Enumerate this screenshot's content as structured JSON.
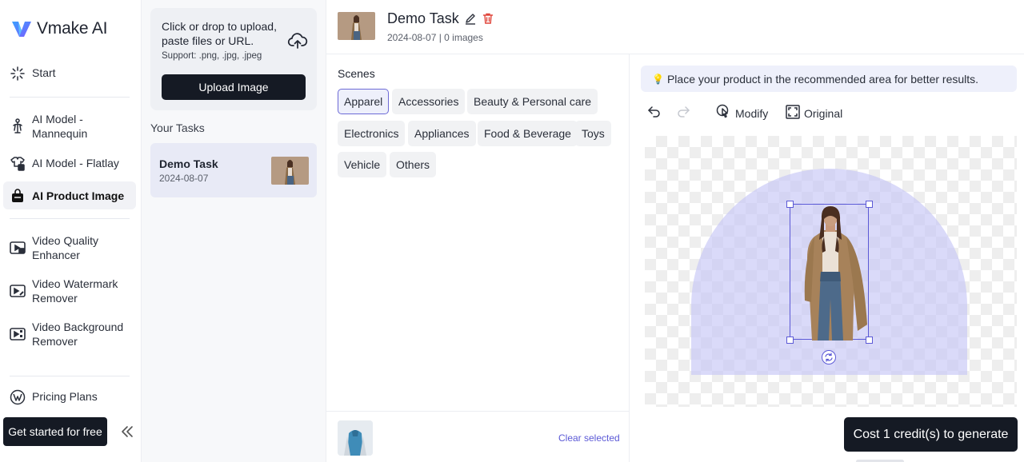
{
  "app": {
    "name": "Vmake AI"
  },
  "sidebar": {
    "items": [
      {
        "label": "Start",
        "icon": "sparkle-icon"
      },
      {
        "label": "AI Model - Mannequin",
        "icon": "mannequin-icon"
      },
      {
        "label": "AI Model - Flatlay",
        "icon": "flatlay-icon"
      },
      {
        "label": "AI Product Image",
        "icon": "shopping-bag-icon",
        "active": true
      },
      {
        "label": "Video Quality Enhancer",
        "icon": "video-hd-icon"
      },
      {
        "label": "Video Watermark Remover",
        "icon": "video-eraser-icon"
      },
      {
        "label": "Video Background Remover",
        "icon": "video-bg-icon"
      },
      {
        "label": "Pricing Plans",
        "icon": "pricing-icon"
      }
    ],
    "cta_label": "Get started for free"
  },
  "tasks_panel": {
    "upload_title": "Click or drop to upload, paste files or URL.",
    "upload_support": "Support: .png, .jpg, .jpeg",
    "upload_button": "Upload Image",
    "your_tasks_label": "Your Tasks",
    "tasks": [
      {
        "name": "Demo Task",
        "date": "2024-08-07"
      }
    ]
  },
  "header": {
    "title": "Demo Task",
    "meta": "2024-08-07 | 0 images"
  },
  "scenes": {
    "label": "Scenes",
    "chips": [
      {
        "label": "Apparel",
        "selected": true
      },
      {
        "label": "Accessories"
      },
      {
        "label": "Beauty & Personal care"
      },
      {
        "label": "Electronics"
      },
      {
        "label": "Appliances"
      },
      {
        "label": "Food & Beverage"
      },
      {
        "label": "Toys"
      },
      {
        "label": "Vehicle"
      },
      {
        "label": "Others"
      }
    ],
    "clear_selected": "Clear selected"
  },
  "canvas": {
    "tip": "Place your product in the recommended area for better results.",
    "tools": {
      "modify": "Modify",
      "original": "Original"
    },
    "generate_label": "Cost 1 credit(s) to generate"
  },
  "colors": {
    "accent": "#5b59d6",
    "dark": "#151a24",
    "arch": "#c4c4f6",
    "delete": "#e0453a"
  }
}
